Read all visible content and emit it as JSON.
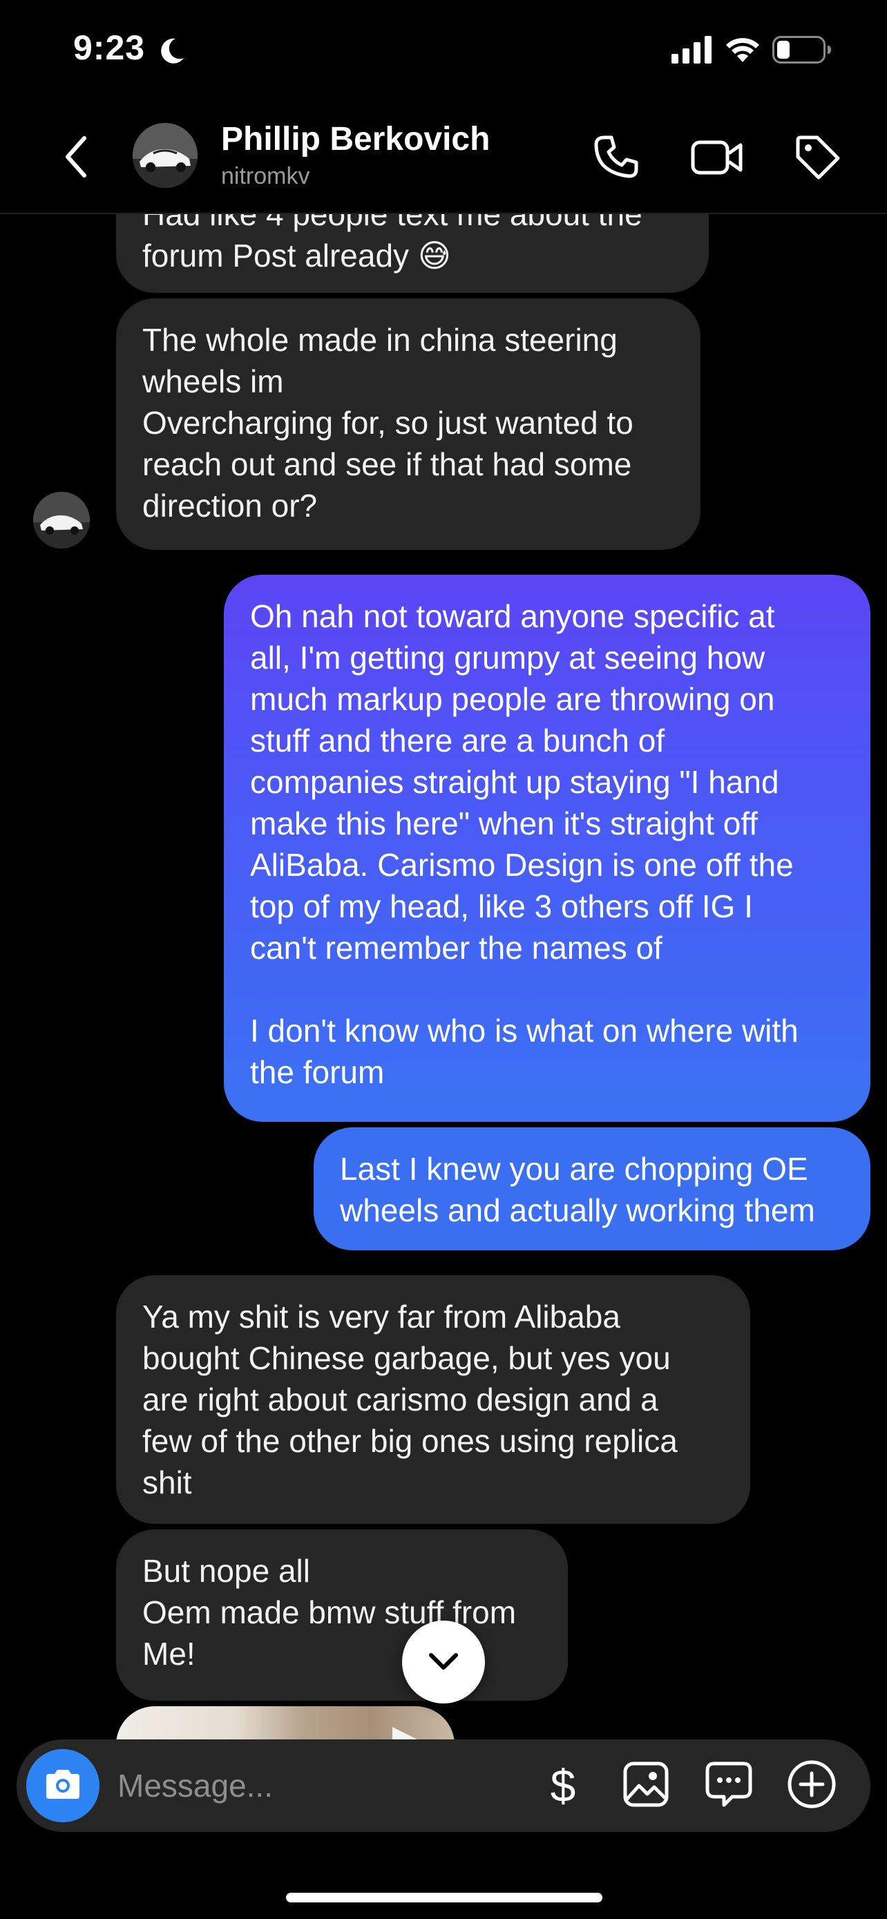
{
  "status_bar": {
    "time": "9:23"
  },
  "header": {
    "name": "Phillip Berkovich",
    "handle": "nitromkv"
  },
  "messages": [
    {
      "direction": "in",
      "text": "Had like 4 people text me about the\nforum Post already 😅"
    },
    {
      "direction": "in",
      "text": "The whole made in china steering\nwheels im\nOvercharging for, so just wanted to\nreach out and see if that had some\ndirection or?"
    },
    {
      "direction": "out",
      "text": "Oh nah not toward anyone specific at\nall, I'm getting grumpy at seeing how\nmuch markup people are throwing on\nstuff and there are a bunch of\ncompanies straight up staying \"I hand\nmake this here\" when it's straight off\nAliBaba. Carismo Design is one off the\ntop of my head, like 3 others off IG I\ncan't remember the names of\n\nI don't know who is what on where with\nthe forum"
    },
    {
      "direction": "out",
      "text": "Last I knew you are chopping OE\nwheels and actually working them"
    },
    {
      "direction": "in",
      "text": "Ya my shit is very far from Alibaba\nbought Chinese garbage, but yes you\nare right about carismo design and a\nfew of the other big ones using replica\nshit"
    },
    {
      "direction": "in",
      "text": "But nope all\nOem made bmw stuff from\nMe!"
    }
  ],
  "composer": {
    "placeholder": "Message...",
    "value": ""
  },
  "icons": {
    "back": "chevron-left-icon",
    "call": "phone-icon",
    "video": "video-camera-icon",
    "tag": "tag-icon",
    "camera": "camera-icon",
    "dollar": "$",
    "gallery": "image-icon",
    "sticker": "chat-bubble-icon",
    "plus": "plus-circle-icon",
    "scroll": "chevron-down-icon"
  },
  "colors": {
    "background": "#000000",
    "incoming_bubble": "#262626",
    "outgoing_top": "#5b45f5",
    "outgoing_bottom": "#3a72f3",
    "camera_button": "#2f84f4"
  }
}
